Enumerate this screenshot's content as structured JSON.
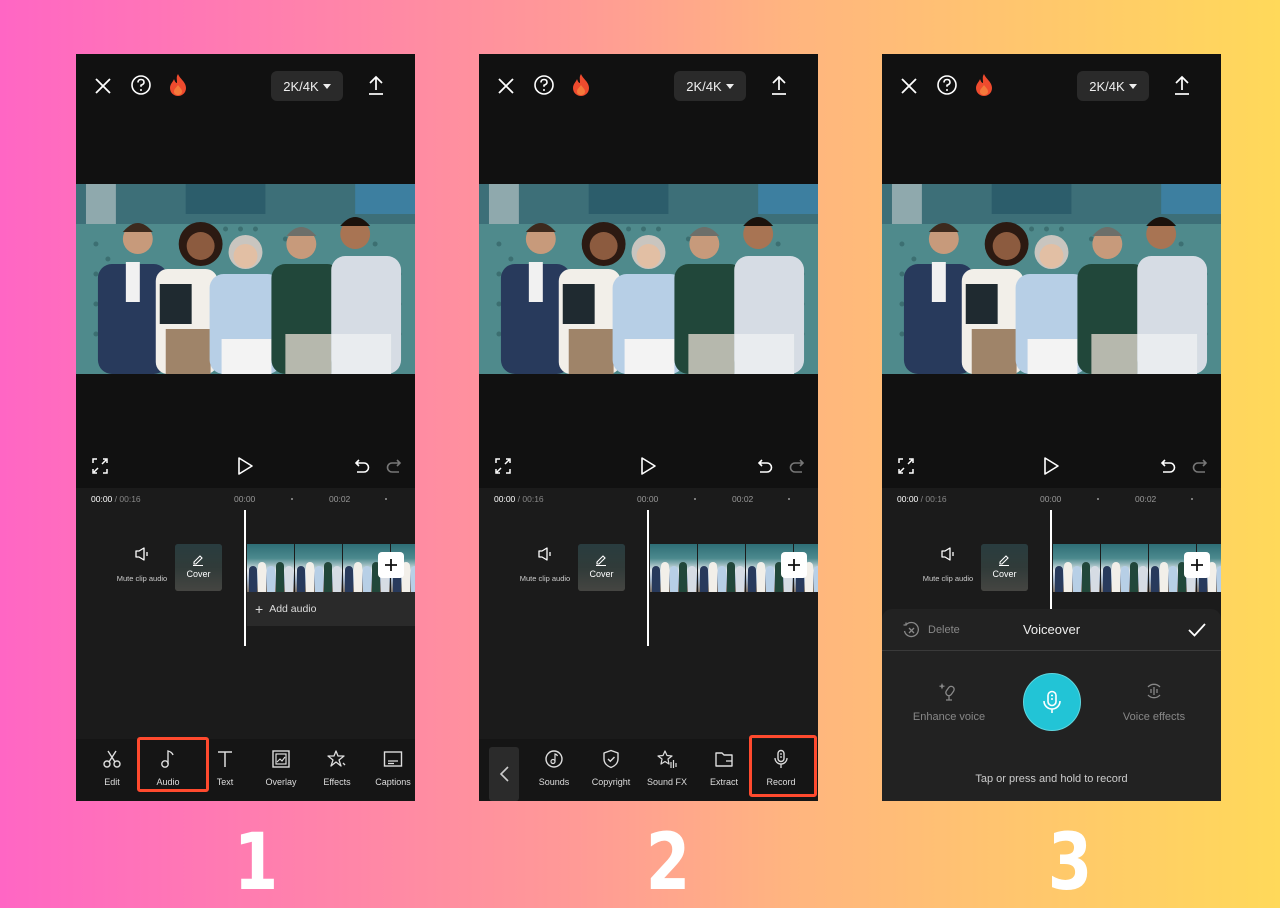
{
  "background": {
    "gradient_start": "#ff66c4",
    "gradient_end": "#ffd95a"
  },
  "colors": {
    "highlight": "#ff4a2e",
    "record_accent": "#22c4d6",
    "fire": "#ef4b2e",
    "panel_dark": "#111111"
  },
  "topbar": {
    "close_icon": "close-icon",
    "help_icon": "help-circle-icon",
    "pro_icon": "fire-icon",
    "resolution_label": "2K/4K",
    "export_icon": "upload-icon"
  },
  "playback": {
    "fullscreen_icon": "fullscreen-icon",
    "play_icon": "play-icon",
    "undo_icon": "undo-icon",
    "redo_icon": "redo-icon"
  },
  "timeline": {
    "current_time": "00:00",
    "total_time": "/ 00:16",
    "ticks": [
      "00:00",
      "00:02"
    ],
    "mute_label": "Mute clip audio",
    "cover_label": "Cover",
    "add_audio_label": "Add audio"
  },
  "screens": [
    {
      "step": "1",
      "toolbar": [
        {
          "label": "Edit",
          "icon": "scissors-icon"
        },
        {
          "label": "Audio",
          "icon": "music-note-icon",
          "highlighted": true
        },
        {
          "label": "Text",
          "icon": "text-icon"
        },
        {
          "label": "Overlay",
          "icon": "overlay-icon"
        },
        {
          "label": "Effects",
          "icon": "effects-star-icon"
        },
        {
          "label": "Captions",
          "icon": "captions-icon"
        }
      ]
    },
    {
      "step": "2",
      "toolbar": [
        {
          "label": "Sounds",
          "icon": "sounds-icon"
        },
        {
          "label": "Copyright",
          "icon": "copyright-shield-icon"
        },
        {
          "label": "Sound FX",
          "icon": "sound-fx-icon"
        },
        {
          "label": "Extract",
          "icon": "folder-icon"
        },
        {
          "label": "Record",
          "icon": "microphone-icon",
          "highlighted": true
        }
      ]
    },
    {
      "step": "3",
      "voiceover": {
        "delete_label": "Delete",
        "title": "Voiceover",
        "enhance_label": "Enhance voice",
        "effects_label": "Voice effects",
        "hint": "Tap or press and hold to record"
      }
    }
  ]
}
